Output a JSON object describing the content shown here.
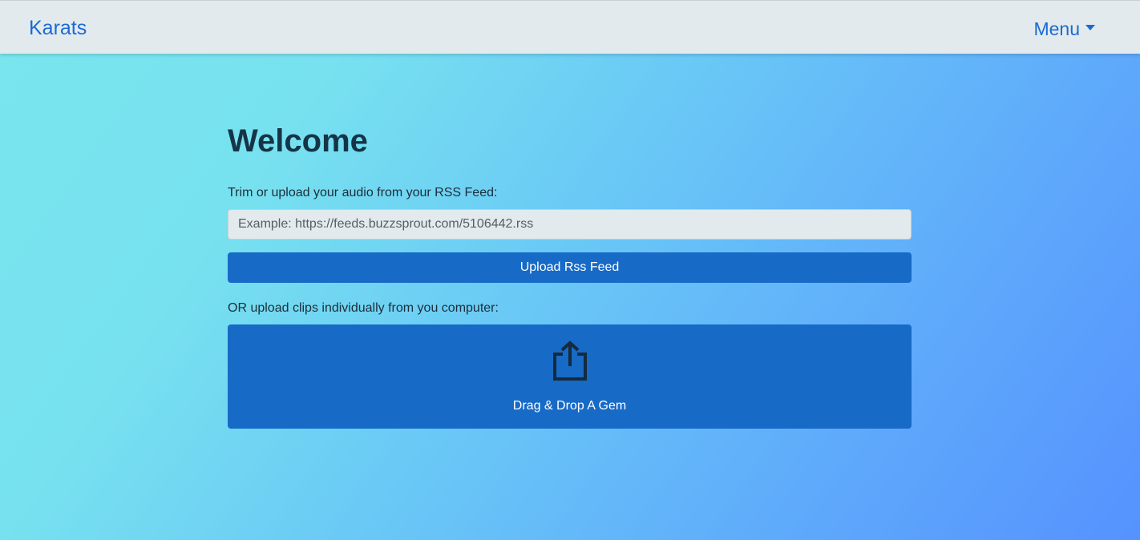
{
  "navbar": {
    "brand": "Karats",
    "menu_label": "Menu",
    "accent_color": "#1a6bd4"
  },
  "main": {
    "title": "Welcome",
    "rss_label": "Trim or upload your audio from your RSS Feed:",
    "rss_input": {
      "value": "",
      "placeholder": "Example: https://feeds.buzzsprout.com/5106442.rss"
    },
    "upload_button_label": "Upload Rss Feed",
    "clips_label": "OR upload clips individually from you computer:",
    "dropzone": {
      "icon": "share-upload-icon",
      "label": "Drag & Drop A Gem"
    },
    "button_color": "#176ac6"
  }
}
